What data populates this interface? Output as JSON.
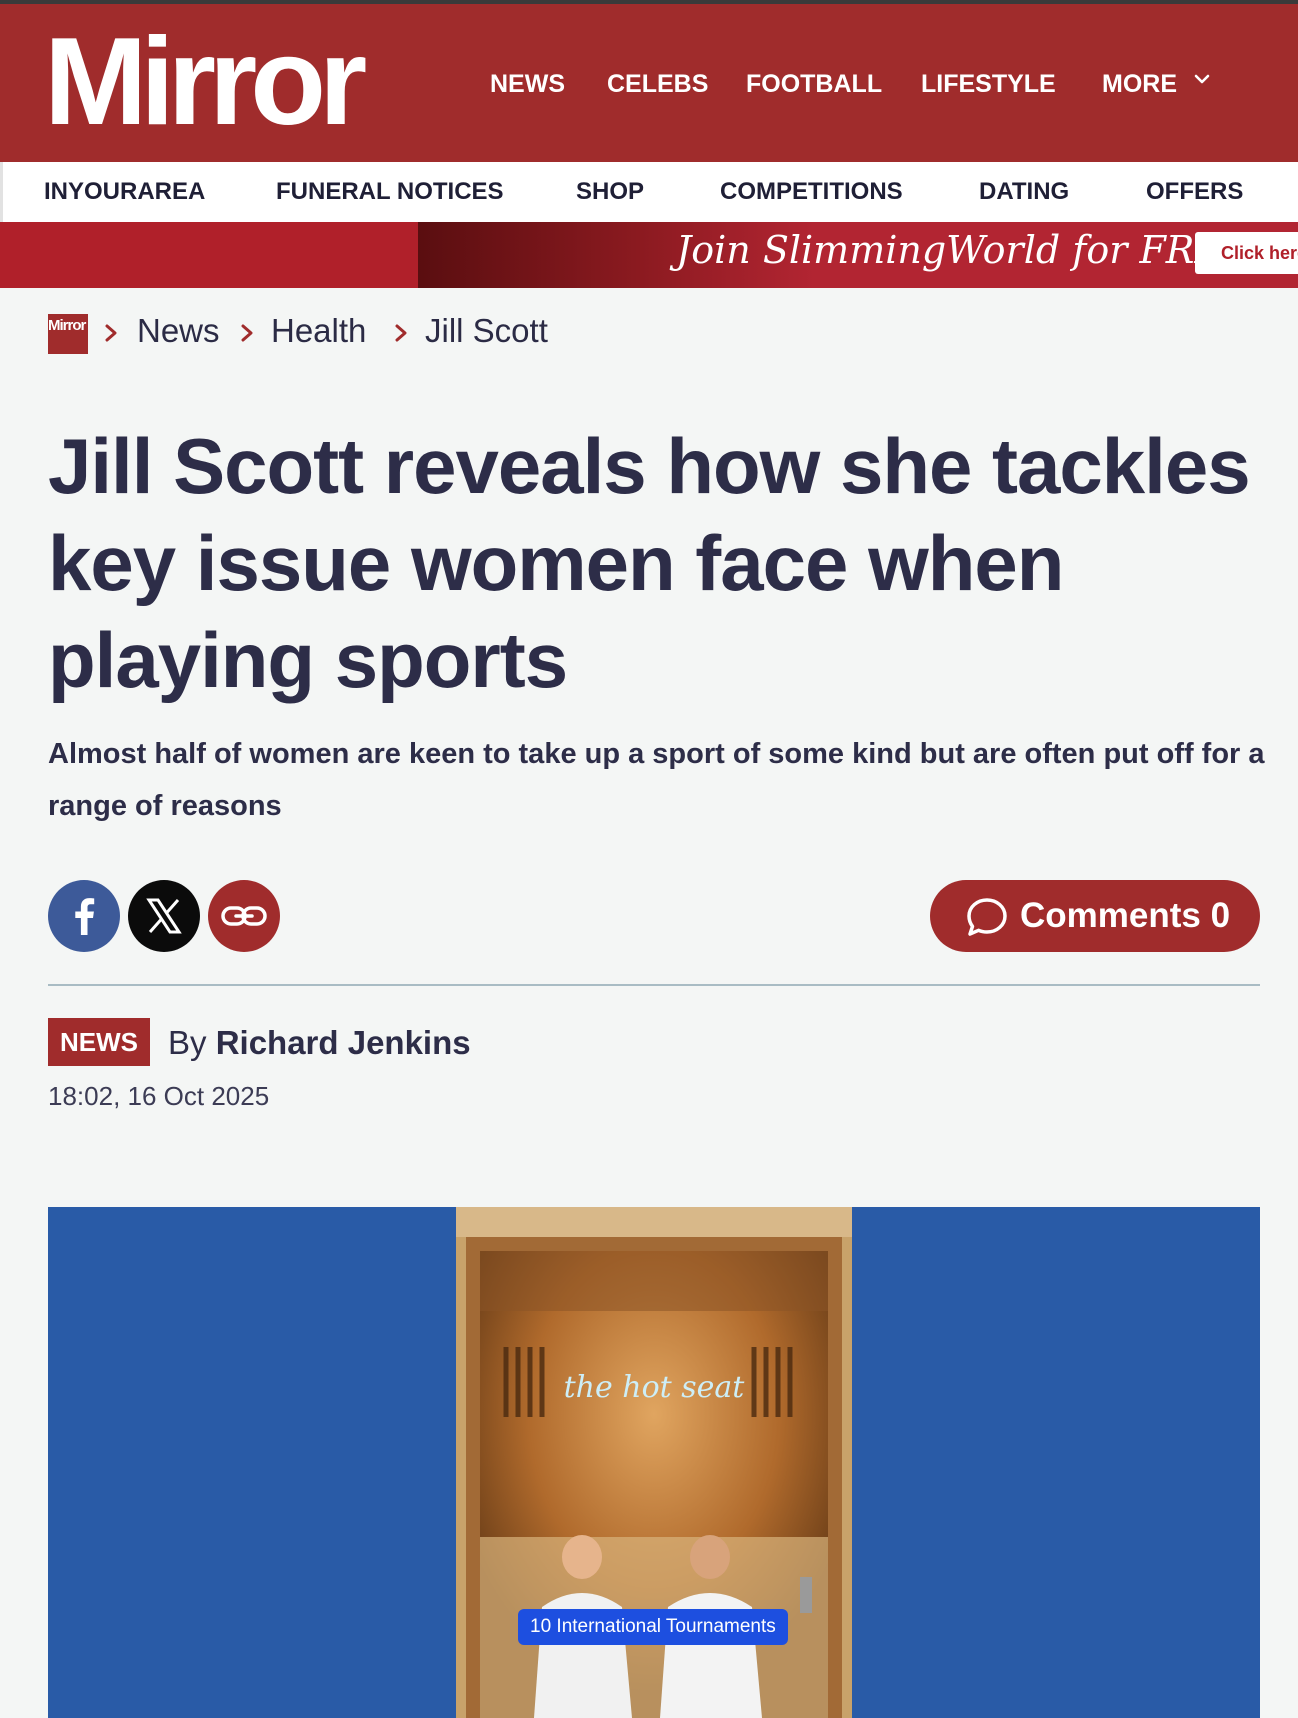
{
  "brand": {
    "logo_text": "Mirror",
    "colors": {
      "primary": "#a02c2c",
      "promo": "#b0202a",
      "text": "#2d2d48",
      "video_bg": "#295ba7"
    }
  },
  "main_nav": {
    "items": [
      "NEWS",
      "CELEBS",
      "FOOTBALL",
      "LIFESTYLE",
      "MORE"
    ],
    "more_icon": "chevron-down-icon"
  },
  "sub_nav": {
    "items": [
      "INYOURAREA",
      "FUNERAL NOTICES",
      "SHOP",
      "COMPETITIONS",
      "DATING",
      "OFFERS"
    ]
  },
  "promo": {
    "text": "Join SlimmingWorld for FREE!",
    "button": "Click here"
  },
  "breadcrumb": {
    "home_logo": "Mirror",
    "items": [
      "News",
      "Health",
      "Jill Scott"
    ],
    "separator_icon": "chevron-right-icon"
  },
  "article": {
    "headline": "Jill Scott reveals how she tackles key issue women face when playing sports",
    "standfirst": "Almost half of women are keen to take up a sport of some kind but are often put off for a range of reasons",
    "section_badge": "NEWS",
    "byline_prefix": "By",
    "author": "Richard Jenkins",
    "timestamp": "18:02, 16 Oct 2025"
  },
  "share": {
    "buttons": [
      {
        "icon": "facebook-icon",
        "color": "#3d5a99"
      },
      {
        "icon": "x-icon",
        "color": "#0b0b0b"
      },
      {
        "icon": "link-icon",
        "color": "#a02c2c"
      }
    ]
  },
  "comments": {
    "label": "Comments 0",
    "icon": "speech-bubble-icon"
  },
  "video": {
    "sign_text": "the hot seat",
    "caption": "10 International Tournaments"
  }
}
